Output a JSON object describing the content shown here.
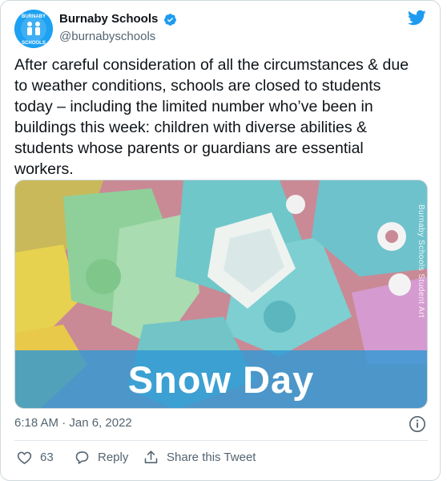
{
  "author": {
    "display_name": "Burnaby Schools",
    "handle": "@burnabyschools",
    "avatar_text_top": "BURNABY",
    "avatar_text_bottom": "SCHOOLS"
  },
  "tweet": {
    "text": "After careful consideration of all the circumstances & due to weather conditions, schools are closed to students today – including the limited number who’ve been in buildings this week: children with diverse abilities & students whose parents or guardians are essential workers.",
    "timestamp": "6:18 AM · Jan 6, 2022"
  },
  "media": {
    "title": "Snow Day",
    "credit": "Burnaby Schools Student Art"
  },
  "actions": {
    "like_count": "63",
    "reply_label": "Reply",
    "share_label": "Share this Tweet"
  },
  "colors": {
    "brand": "#1da1f2",
    "text": "#0f1419",
    "muted": "#536471",
    "banner": "#3199d4"
  },
  "icons": [
    "verified-badge-icon",
    "twitter-bird-icon",
    "info-icon",
    "heart-icon",
    "reply-icon",
    "share-icon"
  ]
}
